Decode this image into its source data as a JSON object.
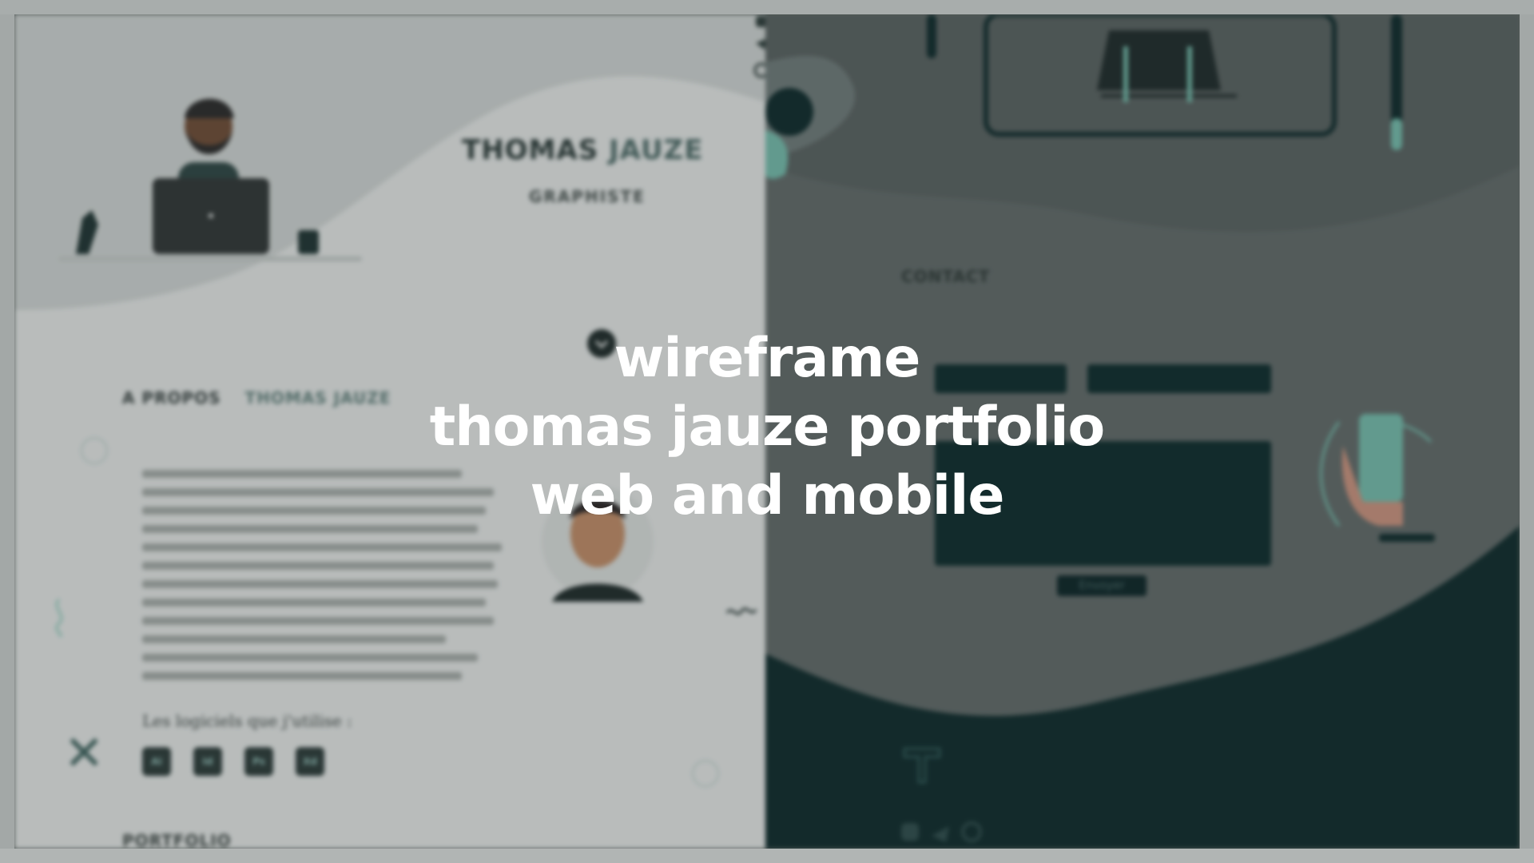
{
  "hero": {
    "first_name": "THOMAS",
    "last_name": "JAUZE",
    "role": "GRAPHISTE"
  },
  "about": {
    "title": "A PROPOS",
    "title_name": "THOMAS JAUZE"
  },
  "software": {
    "title": "Les logiciels que j'utilise :",
    "items": [
      "Ai",
      "Id",
      "Ps",
      "Xd"
    ]
  },
  "portfolio": {
    "title": "PORTFOLIO"
  },
  "contact": {
    "title": "CONTACT",
    "send_label": "Envoyer"
  },
  "headline": {
    "line1": "wireframe",
    "line2": "thomas jauze portfolio",
    "line3": "web and mobile"
  },
  "colors": {
    "dark_teal": "#0e2b2c",
    "accent_green": "#6fb3a4",
    "light_bg": "#d9dcdb"
  },
  "icons": [
    "instagram-icon",
    "twitter-icon",
    "dribbble-icon",
    "close-icon",
    "logo-icon"
  ]
}
